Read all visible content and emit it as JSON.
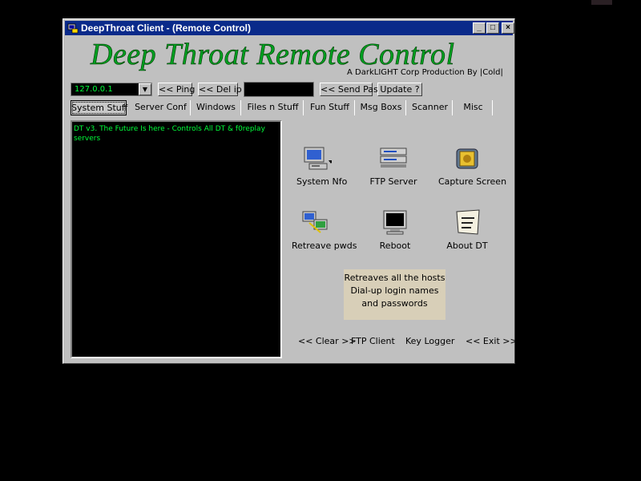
{
  "window": {
    "title": "DeepThroat Client - (Remote Control)",
    "banner": "Deep Throat Remote Control",
    "subtitle": "A DarkLIGHT Corp Production By |Cold|",
    "controls": {
      "minimize": "_",
      "maximize": "□",
      "close": "×"
    }
  },
  "toolbar": {
    "ip_value": "127.0.0.1",
    "ping_label": "<< Ping",
    "delip_label": "<< Del ip",
    "password_value": "",
    "sendpass_label": "<< Send Pass",
    "update_label": "Update ?"
  },
  "tabs": [
    {
      "label": "System Stuff",
      "selected": true
    },
    {
      "label": "Server Conf"
    },
    {
      "label": "Windows"
    },
    {
      "label": "Files n Stuff"
    },
    {
      "label": "Fun Stuff"
    },
    {
      "label": "Msg Boxs"
    },
    {
      "label": "Scanner"
    },
    {
      "label": "Misc"
    }
  ],
  "console": {
    "text": "DT v3. The Future Is here - Controls All DT & f0replay servers"
  },
  "actions": [
    {
      "label": "System Nfo",
      "icon": "computer-icon"
    },
    {
      "label": "FTP Server",
      "icon": "server-icon"
    },
    {
      "label": "Capture Screen",
      "icon": "camera-icon"
    },
    {
      "label": "Retreave pwds",
      "icon": "network-icon"
    },
    {
      "label": "Reboot",
      "icon": "monitor-icon"
    },
    {
      "label": "About DT",
      "icon": "readme-icon"
    }
  ],
  "tooltip": "Retreaves all the hosts Dial-up login names and passwords",
  "bottom": {
    "clear_label": "<< Clear >>",
    "ftp_client_label": "FTP Client",
    "keylogger_label": "Key Logger",
    "exit_label": "<< Exit >>"
  },
  "colors": {
    "console_text": "#00ff3a",
    "title_bar": "#0a2a8a",
    "banner": "#00a020",
    "tooltip_bg": "#d8cfb8"
  }
}
